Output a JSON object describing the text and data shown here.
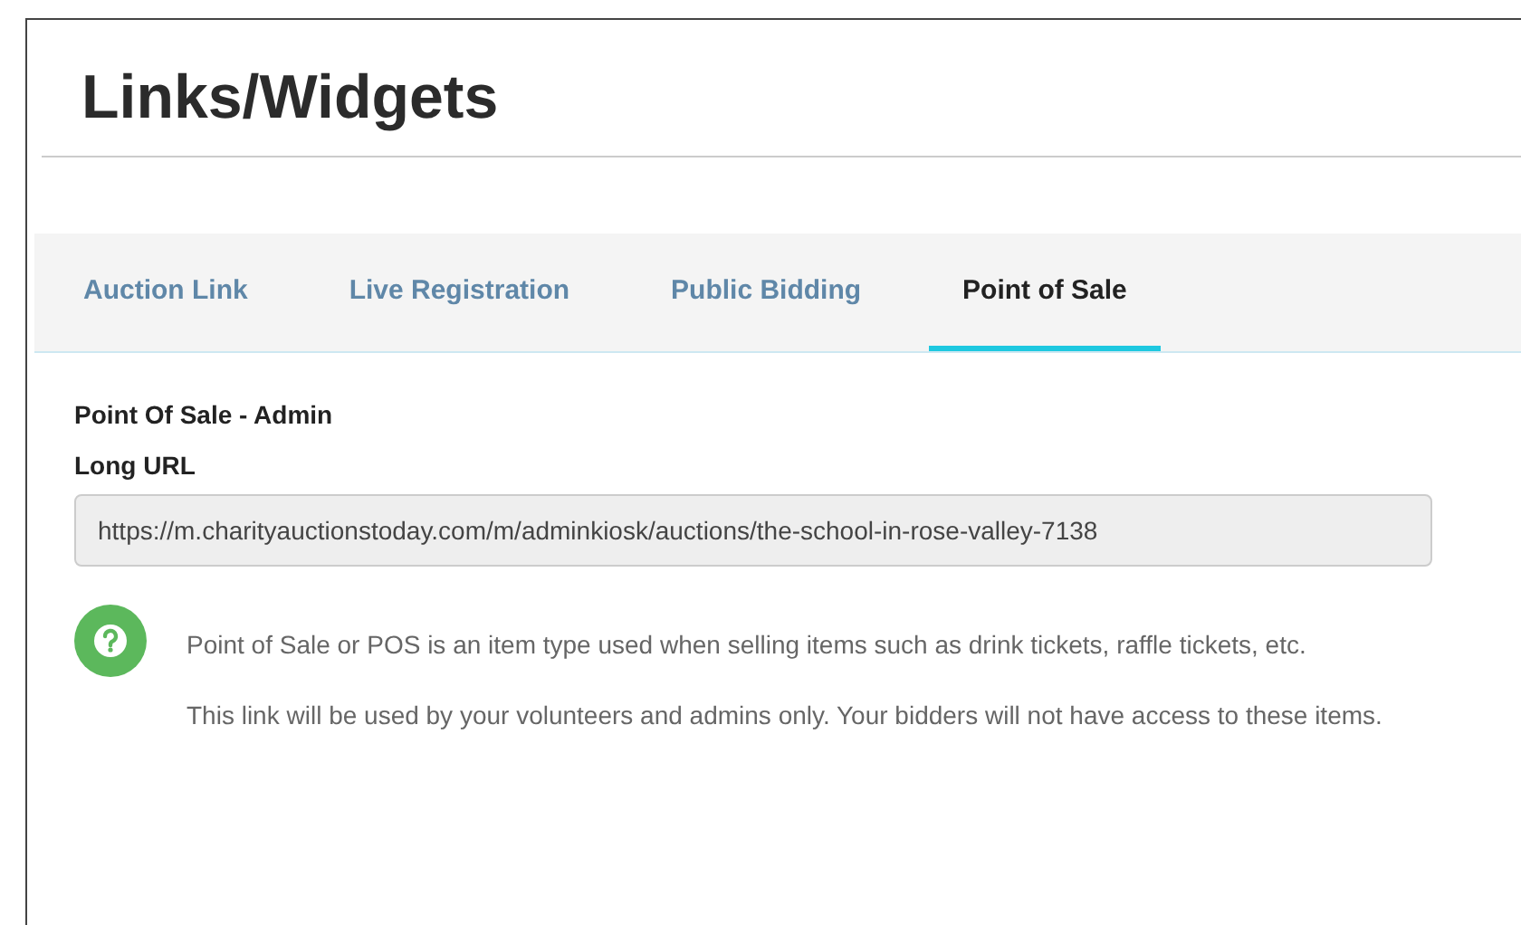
{
  "page": {
    "title": "Links/Widgets"
  },
  "tabs": [
    {
      "label": "Auction Link",
      "selected": false
    },
    {
      "label": "Live Registration",
      "selected": false
    },
    {
      "label": "Public Bidding",
      "selected": false
    },
    {
      "label": "Point of Sale",
      "selected": true
    }
  ],
  "section": {
    "heading": "Point Of Sale - Admin",
    "field_label": "Long URL",
    "field_value": "https://m.charityauctionstoday.com/m/adminkiosk/auctions/the-school-in-rose-valley-7138"
  },
  "info": {
    "paragraphs": [
      "Point of Sale or POS is an item type used when selling items such as drink tickets, raffle tickets, etc.",
      "This link will be used by your volunteers and admins only. Your bidders will not have access to these items."
    ]
  }
}
